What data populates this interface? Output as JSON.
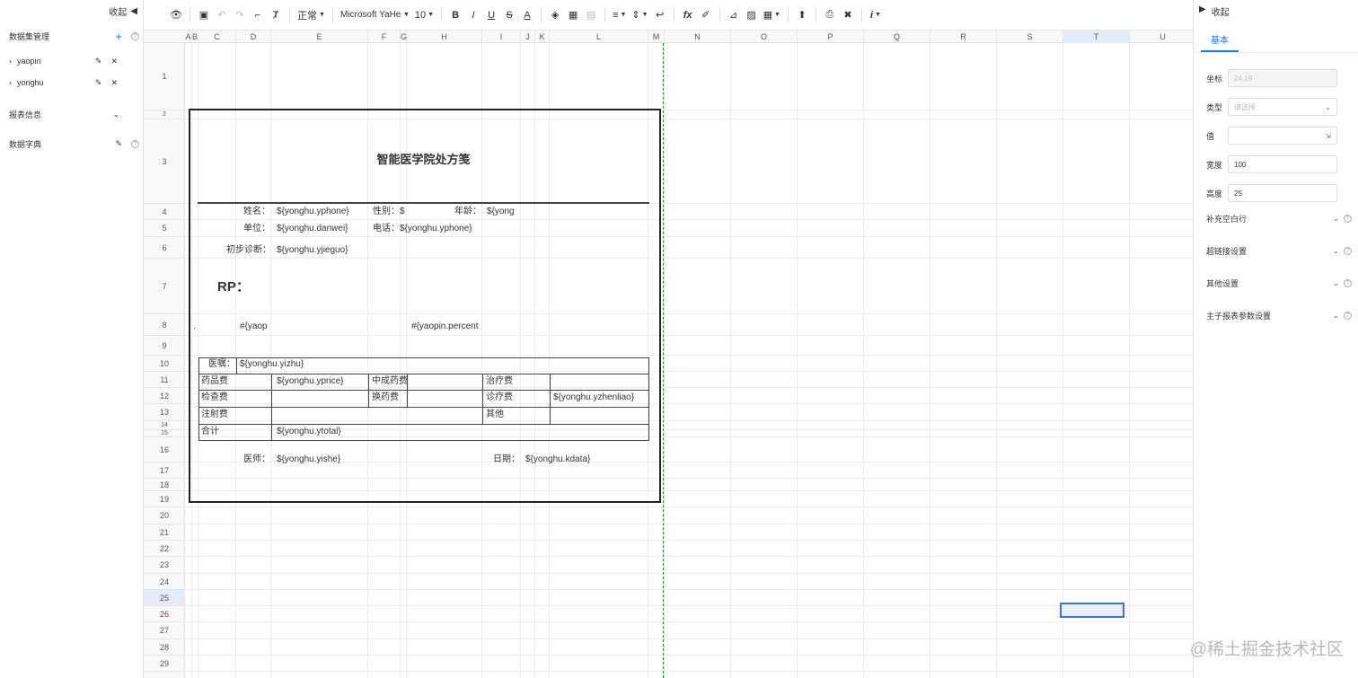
{
  "left_panel": {
    "collapse_label": "收起",
    "dataset_title": "数据集管理",
    "datasets": [
      "yaopin",
      "yonghu"
    ],
    "report_info_label": "报表信息",
    "dictionary_label": "数据字典"
  },
  "toolbar": {
    "style_value": "正常",
    "font_value": "Microsoft YaHei",
    "size_value": "10"
  },
  "grid": {
    "columns": [
      "A",
      "B",
      "C",
      "D",
      "E",
      "F",
      "G",
      "H",
      "I",
      "J",
      "K",
      "L",
      "M",
      "N",
      "O",
      "P",
      "Q",
      "R",
      "S",
      "T",
      "U"
    ],
    "rows": [
      "1",
      "2",
      "3",
      "4",
      "5",
      "6",
      "7",
      "8",
      "9",
      "10",
      "11",
      "12",
      "13",
      "14",
      "15",
      "16",
      "17",
      "18",
      "19",
      "20",
      "21",
      "22",
      "23",
      "24",
      "25",
      "26",
      "27",
      "28",
      "29"
    ],
    "selected_col": "T",
    "selected_row": "25"
  },
  "report": {
    "title": "智能医学院处方笺",
    "name_label": "姓名：",
    "name_value": "${yonghu.yphone}",
    "gender_label": "性别：",
    "gender_value": "$",
    "age_label": "年龄：",
    "age_value": "${yong",
    "unit_label": "单位：",
    "unit_value": "${yonghu.danwei}",
    "phone_label": "电话：",
    "phone_value": "${yonghu.yphone}",
    "diag_label": "初步诊断：",
    "diag_value": "${yonghu.yjieguo}",
    "rp_label": "RP：",
    "dot": ".",
    "med_name": "#{yaop",
    "med_percent": "#{yaopin.percent",
    "advice_label": "医嘱：",
    "advice_value": "${yonghu.yizhu}",
    "drug_fee": "药品费",
    "drug_fee_value": "${yonghu.yprice}",
    "herb_fee": "中成药费",
    "treat_fee": "治疗费",
    "check_fee": "检查费",
    "dressing_fee": "换药费",
    "consult_fee": "诊疗费",
    "consult_fee_value": "${yonghu.yzhenliao}",
    "inject_fee": "注射费",
    "other_fee": "其他",
    "total_label": "合计",
    "total_value": "${yonghu.ytotal}",
    "doctor_label": "医师：",
    "doctor_value": "${yonghu.yishe}",
    "date_label": "日期：",
    "date_value": "${yonghu.kdata}"
  },
  "right_panel": {
    "collapse_label": "收起",
    "tab_basic": "基本",
    "coord_label": "坐标",
    "coord_value": "24,19",
    "type_label": "类型",
    "type_placeholder": "请选择",
    "value_label": "值",
    "width_label": "宽度",
    "width_value": "100",
    "height_label": "高度",
    "height_value": "25",
    "sections": [
      "补充空白行",
      "超链接设置",
      "其他设置",
      "主子报表参数设置"
    ]
  },
  "watermark": "@稀土掘金技术社区"
}
